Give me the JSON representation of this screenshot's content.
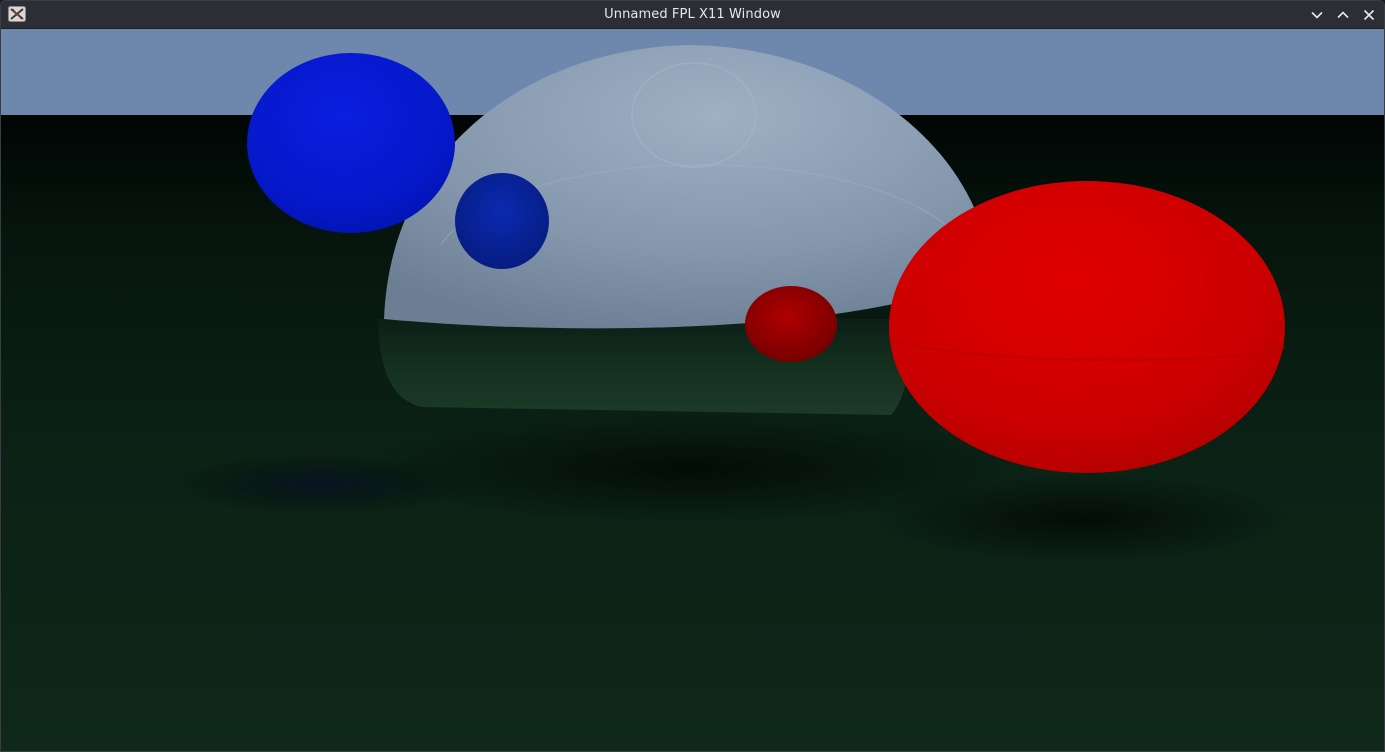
{
  "window": {
    "title": "Unnamed FPL X11 Window",
    "icon": "x11-app-icon",
    "controls": [
      "minimize-icon",
      "maximize-icon",
      "close-icon"
    ]
  },
  "scene": {
    "description_icon": "rendered-raytraced-scene",
    "colors": {
      "sky": "#6e87ad",
      "ground": "#0c2518",
      "blue_sphere": "#0010c8",
      "red_sphere": "#d40000",
      "glass_sphere": "#8fa2b8"
    }
  }
}
